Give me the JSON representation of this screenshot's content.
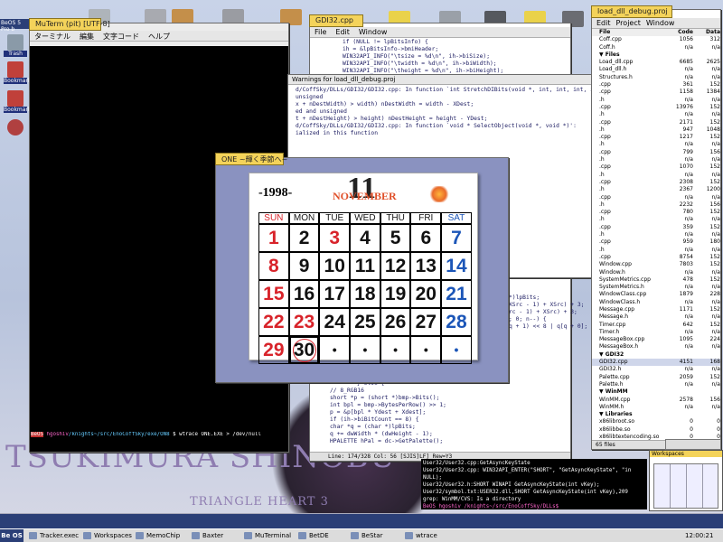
{
  "desktop": {
    "logo_line1": "TSUKIMURA SHINOBU",
    "logo_line2": "TRIANGLE HEART 3",
    "left_icons": [
      "Trash",
      "Bookmark",
      "Bookmark"
    ],
    "top_label": "BeOS 5 Pro b"
  },
  "terminal": {
    "tab_title": "MuTerm (pit) [UTF-8]",
    "menu": [
      "ターミナル",
      "編集",
      "文字コード",
      "ヘルプ"
    ],
    "prompt_user": "BeOS",
    "prompt_host": "hgoshiv",
    "prompt_path": "/knights~/src/EnoCoffSky/exe/ON8",
    "command": "$ wtrace ONE.EXE > /dev/null"
  },
  "gdi_editor": {
    "tab_title": "GDI32.cpp",
    "menu": [
      "File",
      "Edit",
      "Window"
    ],
    "lines": [
      "if (NULL != lpBitsInfo) {",
      "  ih = &lpBitsInfo->bmiHeader;",
      "  WIN32API_INFO(\"\\tsize = %d\\n\", ih->biSize);",
      "  WIN32API_INFO(\"\\twidth = %d\\n\", ih->biWidth);",
      "  WIN32API_INFO(\"\\theight = %d\\n\", ih->biHeight);"
    ],
    "status": "Line: 174/328 Col: 56 [SJIS]LF] Rew=Y3"
  },
  "warnings": {
    "title": "Warnings for load_dll_debug.proj",
    "lines": [
      "d/CoffSky/DLLs/GDI32/GDI32.cpp: In function `int StretchDIBits(void *, int, int, int, int, int, int, int, int,",
      "unsigned",
      "x + nDestWidth) > width) nDestWidth = width - XDest;",
      "ed and unsigned",
      "t + nDestHeight) > height) nDestHeight = height - YDest;",
      "d/CoffSky/DLLs/GDI32/GDI32.cpp: In function `void * SelectObject(void *, void *)':",
      "ialized in this function"
    ]
  },
  "lower_code": {
    "lines": [
      "} else {",
      "  // 8_RGB16",
      "  short *p = (short *)bmp->Bits();",
      "  int bpl = bmp->BytesPerRow() >> 1;",
      "  p = &p[bpl * Ydest + Xdest];",
      "  if (ih->biBitCount == 8) {",
      "    char *q = (char *)lpBits;",
      "    q += dwWidth * (dwHeight - 1);",
      "    HPALETTE hPal = dc->GetPalette();",
      "    palette_t *pal = (palette_t *)hPal;"
    ],
    "right_lines": [
      "*)lpBits;",
      "XSrc - 1) + XSrc) + 3;",
      "rc - 1) + XSrc) + 3;",
      "",
      "; 0; n--) {",
      "q + 1) << 8 | q[q + 0];"
    ]
  },
  "calendar": {
    "tab_title": "ONE ~輝く季節へ~",
    "year": "-1998-",
    "month_number": "11",
    "month_name": "NOVEMBER",
    "weekdays": [
      "SUN",
      "MON",
      "TUE",
      "WED",
      "THU",
      "FRI",
      "SAT"
    ],
    "weeks": [
      [
        "1",
        "2",
        "3",
        "4",
        "5",
        "6",
        "7"
      ],
      [
        "8",
        "9",
        "10",
        "11",
        "12",
        "13",
        "14"
      ],
      [
        "15",
        "16",
        "17",
        "18",
        "19",
        "20",
        "21"
      ],
      [
        "22",
        "23",
        "24",
        "25",
        "26",
        "27",
        "28"
      ],
      [
        "29",
        "30",
        "•",
        "•",
        "•",
        "•",
        "•"
      ]
    ],
    "colors": {
      "sun": "#d8232a",
      "sat": "#1c56b8",
      "weekday": "#111111",
      "holiday": "#d8232a",
      "month": "#e0502a"
    }
  },
  "project": {
    "tab_title": "load_dll_debug.proj",
    "menu": [
      "Edit",
      "Project",
      "Window"
    ],
    "columns": [
      "File",
      "Code",
      "Data"
    ],
    "rows": [
      [
        "Coff.cpp",
        "1056",
        "312"
      ],
      [
        "Coff.h",
        "n/a",
        "n/a"
      ],
      [
        "▼ Files",
        "",
        ""
      ],
      [
        "Load_dll.cpp",
        "6685",
        "2625"
      ],
      [
        "Load_dll.h",
        "n/a",
        "n/a"
      ],
      [
        "",
        "",
        ""
      ],
      [
        "Structures.h",
        "n/a",
        "n/a"
      ],
      [
        ".cpp",
        "361",
        "152"
      ],
      [
        ".cpp",
        "1158",
        "1384"
      ],
      [
        ".h",
        "n/a",
        "n/a"
      ],
      [
        ".cpp",
        "13976",
        "152"
      ],
      [
        ".h",
        "n/a",
        "n/a"
      ],
      [
        ".cpp",
        "2171",
        "152"
      ],
      [
        ".h",
        "947",
        "1048"
      ],
      [
        ".cpp",
        "1217",
        "152"
      ],
      [
        ".h",
        "n/a",
        "n/a"
      ],
      [
        ".cpp",
        "799",
        "156"
      ],
      [
        ".h",
        "n/a",
        "n/a"
      ],
      [
        ".cpp",
        "1070",
        "152"
      ],
      [
        ".h",
        "n/a",
        "n/a"
      ],
      [
        ".cpp",
        "2308",
        "152"
      ],
      [
        ".h",
        "2367",
        "1200"
      ],
      [
        ".cpp",
        "n/a",
        "n/a"
      ],
      [
        ".h",
        "2232",
        "156"
      ],
      [
        ".cpp",
        "780",
        "152"
      ],
      [
        ".h",
        "n/a",
        "n/a"
      ],
      [
        ".cpp",
        "359",
        "152"
      ],
      [
        ".h",
        "n/a",
        "n/a"
      ],
      [
        ".cpp",
        "959",
        "180"
      ],
      [
        ".h",
        "n/a",
        "n/a"
      ],
      [
        "",
        "",
        ""
      ],
      [
        ".cpp",
        "8754",
        "152"
      ],
      [
        "Window.cpp",
        "7803",
        "152"
      ],
      [
        "Window.h",
        "n/a",
        "n/a"
      ],
      [
        "SystemMetrics.cpp",
        "478",
        "152"
      ],
      [
        "SystemMetrics.h",
        "n/a",
        "n/a"
      ],
      [
        "WindowClass.cpp",
        "1879",
        "228"
      ],
      [
        "WindowClass.h",
        "n/a",
        "n/a"
      ],
      [
        "Message.cpp",
        "1171",
        "152"
      ],
      [
        "Message.h",
        "n/a",
        "n/a"
      ],
      [
        "Timer.cpp",
        "642",
        "152"
      ],
      [
        "Timer.h",
        "n/a",
        "n/a"
      ],
      [
        "MessageBox.cpp",
        "1095",
        "224"
      ],
      [
        "MessageBox.h",
        "n/a",
        "n/a"
      ],
      [
        "▼ GDI32",
        "",
        ""
      ],
      [
        "GDI32.cpp",
        "4151",
        "168"
      ],
      [
        "GDI32.h",
        "n/a",
        "n/a"
      ],
      [
        "Palette.cpp",
        "2059",
        "152"
      ],
      [
        "Palette.h",
        "n/a",
        "n/a"
      ],
      [
        "▼ WinMM",
        "",
        ""
      ],
      [
        "WinMM.cpp",
        "2578",
        "156"
      ],
      [
        "WinMM.h",
        "n/a",
        "n/a"
      ],
      [
        "▼ Libraries",
        "",
        ""
      ],
      [
        "x86libroot.so",
        "0",
        "0"
      ],
      [
        "x86libbe.so",
        "0",
        "0"
      ],
      [
        "x86libtextencoding.so",
        "0",
        "0"
      ],
      [
        "x86libgame.so",
        "0",
        "0"
      ]
    ],
    "status": "65 files"
  },
  "bottom_terminal": {
    "lines": [
      "User32/User32.cpp:GetAsyncKeyState",
      "User32/User32.cpp:      WIN32API_ENTER(\"SHORT\", \"GetAsyncKeyState\", \"in",
      "  NULL);",
      "User32/User32.h:SHORT WINAPI GetAsyncKeyState(int vKey);",
      "User32/symbol.txt:USER32.dll,SHORT GetAsyncKeyState(int vKey),209",
      "grep: WinMM/CVS: Is a directory"
    ],
    "prompt": "BeOS hgoshiv /knights~/src/EnoCoffSky/DLLs$"
  },
  "workspaces_label": "Workspaces",
  "taskbar": {
    "be_label": "Be OS",
    "items": [
      "Tracker.exec",
      "Workspaces",
      "MemoChip",
      "Baxter",
      "MuTerminal",
      "BetDE",
      "BeStar",
      "wtrace"
    ],
    "clock": "12:00:21"
  }
}
